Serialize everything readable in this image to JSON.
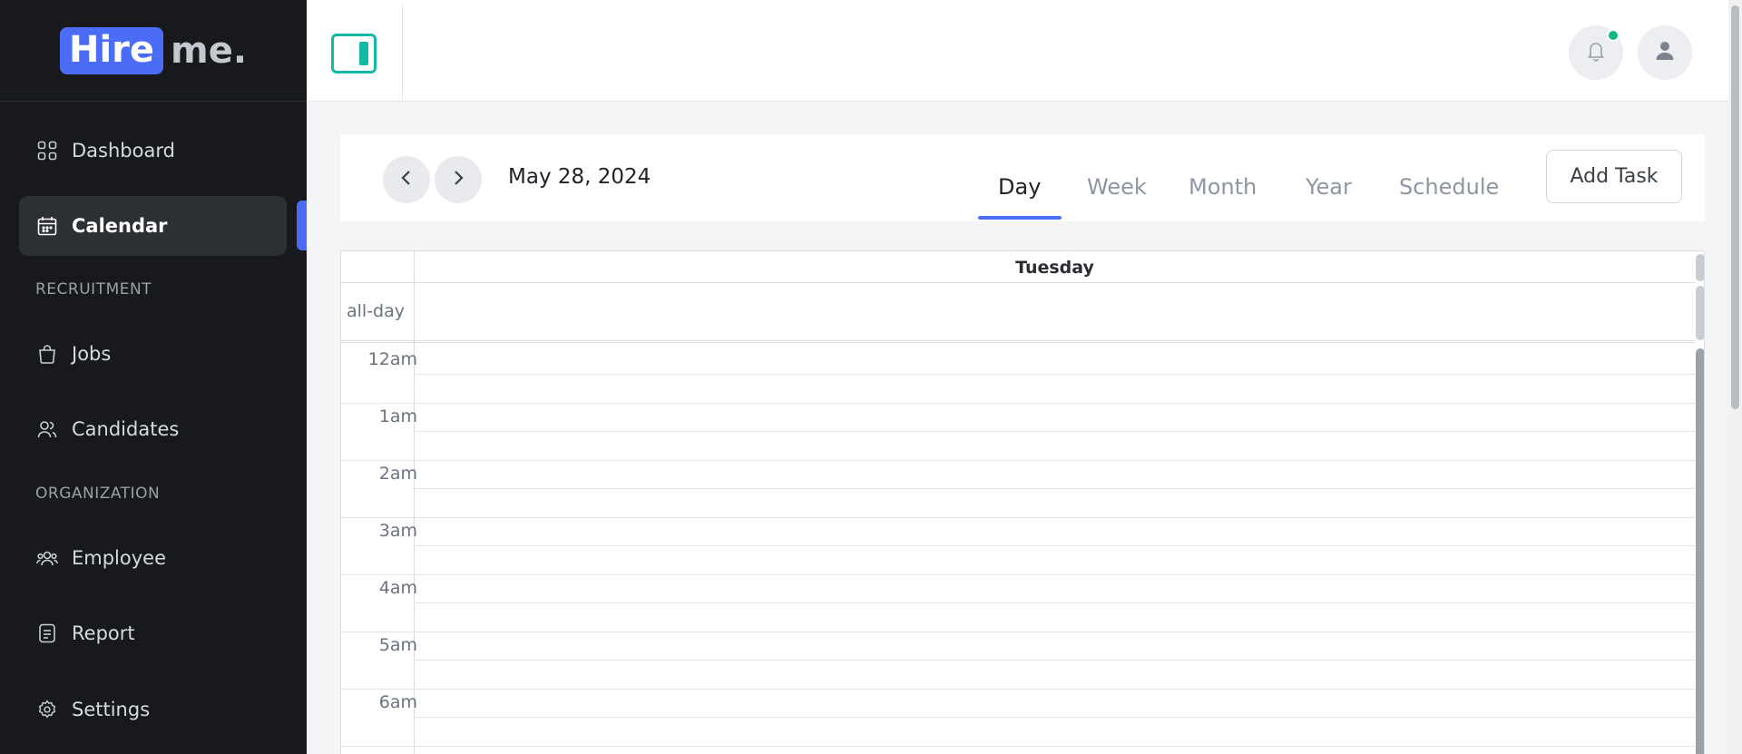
{
  "brand": {
    "part1": "Hire",
    "part2": "me."
  },
  "sidebar": {
    "items": [
      {
        "label": "Dashboard",
        "icon": "dashboard-grid-icon"
      },
      {
        "label": "Calendar",
        "icon": "calendar-icon",
        "active": true
      },
      {
        "label": "Jobs",
        "icon": "shopping-bag-icon"
      },
      {
        "label": "Candidates",
        "icon": "users-icon"
      },
      {
        "label": "Employee",
        "icon": "team-icon"
      },
      {
        "label": "Report",
        "icon": "document-icon"
      },
      {
        "label": "Settings",
        "icon": "gear-icon"
      }
    ],
    "sections": {
      "recruitment": "RECRUITMENT",
      "organization": "ORGANIZATION"
    }
  },
  "topbar": {
    "toggle_icon": "sidebar-toggle-icon",
    "notification_icon": "bell-icon",
    "avatar_icon": "user-icon"
  },
  "calendar": {
    "date": "May 28, 2024",
    "tabs": [
      "Day",
      "Week",
      "Month",
      "Year",
      "Schedule"
    ],
    "active_tab": "Day",
    "add_task_label": "Add Task",
    "day_title": "Tuesday",
    "allday_label": "all-day",
    "hours": [
      "12am",
      "1am",
      "2am",
      "3am",
      "4am",
      "5am",
      "6am"
    ]
  },
  "colors": {
    "accent": "#4b6cf7",
    "teal": "#14b8a6",
    "notif": "#10b981",
    "sidebar_bg": "#17191c"
  }
}
